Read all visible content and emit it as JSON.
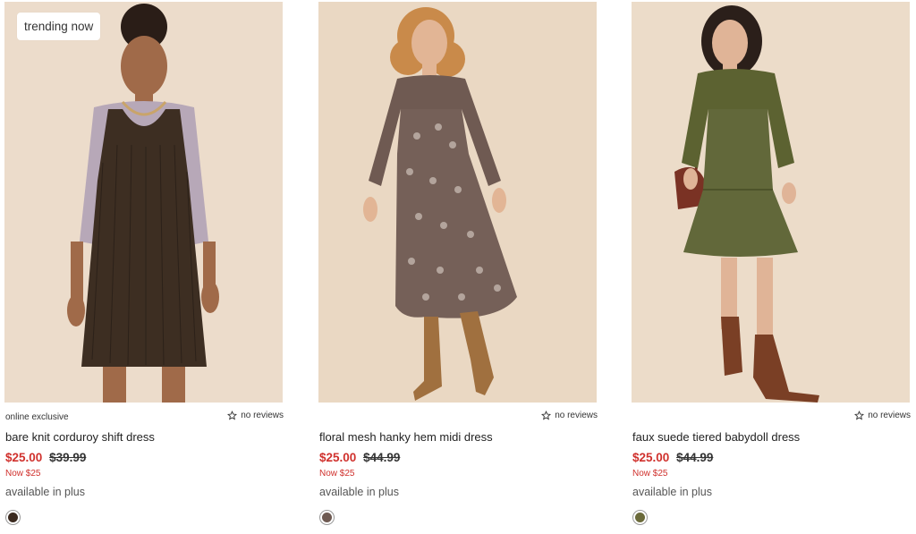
{
  "products": [
    {
      "badge": "trending now",
      "tag": "online exclusive",
      "reviews": "no reviews",
      "name": "bare knit corduroy shift dress",
      "sale_price": "$25.00",
      "original_price": "$39.99",
      "now_text": "Now $25",
      "availability": "available in plus",
      "swatch_color": "#3b2a1f",
      "image_desc_icon": "dress-photo"
    },
    {
      "badge": "",
      "tag": "",
      "reviews": "no reviews",
      "name": "floral mesh hanky hem midi dress",
      "sale_price": "$25.00",
      "original_price": "$44.99",
      "now_text": "Now $25",
      "availability": "available in plus",
      "swatch_color": "#6e5a52",
      "image_desc_icon": "dress-photo"
    },
    {
      "badge": "",
      "tag": "",
      "reviews": "no reviews",
      "name": "faux suede tiered babydoll dress",
      "sale_price": "$25.00",
      "original_price": "$44.99",
      "now_text": "Now $25",
      "availability": "available in plus",
      "swatch_color": "#6b6a3a",
      "image_desc_icon": "dress-photo"
    }
  ],
  "colors": {
    "sale_red": "#d0312d",
    "photo_bg": "#ead9c8"
  }
}
